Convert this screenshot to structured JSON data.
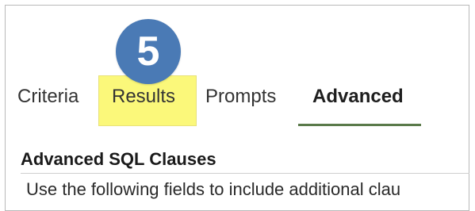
{
  "step_badge": {
    "number": "5",
    "color": "#4a7ab5"
  },
  "highlight_color": "#fbf87a",
  "tabs": [
    {
      "label": "Criteria",
      "selected": false
    },
    {
      "label": "Results",
      "selected": false,
      "highlighted": true
    },
    {
      "label": "Prompts",
      "selected": false
    },
    {
      "label": "Advanced",
      "selected": true
    }
  ],
  "selected_tab_underline_color": "#5a7a4a",
  "section": {
    "title": "Advanced SQL Clauses",
    "description": "Use the following fields to include additional clau"
  }
}
